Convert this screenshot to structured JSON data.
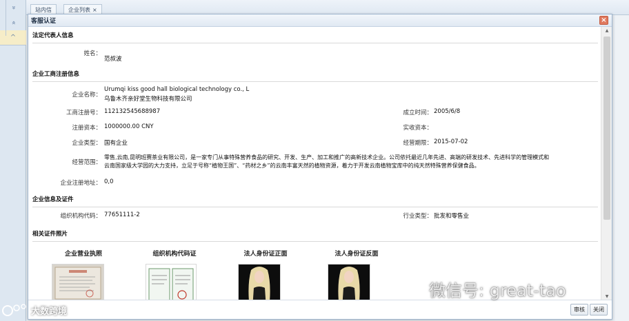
{
  "app": {
    "tabs": [
      {
        "label": "站内信"
      },
      {
        "label": "企业列表"
      }
    ],
    "tab_close": "×",
    "left_buttons": [
      "»",
      "«",
      "^"
    ]
  },
  "dialog": {
    "title": "客服认证",
    "close": "×",
    "sections": {
      "legal_rep": "法定代表人信息",
      "business_reg": "企业工商注册信息",
      "enterprise_cert": "企业信息及证件",
      "photos": "相关证件照片"
    },
    "legal_rep": {
      "name_label": "姓名：",
      "name_value": "范叔波"
    },
    "business_reg": {
      "company_name_label": "企业名称：",
      "company_name_en": "Urumqi kiss good hall biological technology co., L",
      "company_name_cn": "乌鲁木齐亲好堂生物科技有限公司",
      "reg_no_label": "工商注册号：",
      "reg_no_value": "112132545688987",
      "founded_label": "成立时间：",
      "founded_value": "2005/6/8",
      "capital_label": "注册资本：",
      "capital_value": "1000000.00 CNY",
      "paid_capital_label": "实收资本：",
      "paid_capital_value": "",
      "type_label": "企业类型：",
      "type_value": "国有企业",
      "term_label": "经营期限：",
      "term_value": "2015-07-02",
      "scope_label": "经营范围：",
      "scope_line1": "零售,云南,昆明班赛茶业有限公司，是一家专门从事特殊营养食品的研究、开发、生产、加工和推广的高新技术企业。公司依托最近几年先进、高端的研发技术、先进科学的管理模式和",
      "scope_line2": "云南国家级大学园的大力支持，立足于号称“植物王国”、“药材之乡”的云南丰富天然的植物资源，着力于开发云南植物宝库中的纯天然特殊营养保健食品。",
      "address_label": "企业注册地址：",
      "address_value": "0,0"
    },
    "enterprise_cert": {
      "org_code_label": "组织机构代码：",
      "org_code_value": "77651111-2",
      "industry_label": "行业类型：",
      "industry_value": "批发和零售业"
    },
    "photos": [
      {
        "title": "企业营业执照"
      },
      {
        "title": "组织机构代码证"
      },
      {
        "title": "法人身份证正面"
      },
      {
        "title": "法人身份证反面"
      }
    ],
    "buttons": {
      "approve": "审核",
      "close": "关闭"
    }
  },
  "watermark": {
    "wechat": "微信号: great-tao",
    "brand": "大数跨境"
  }
}
